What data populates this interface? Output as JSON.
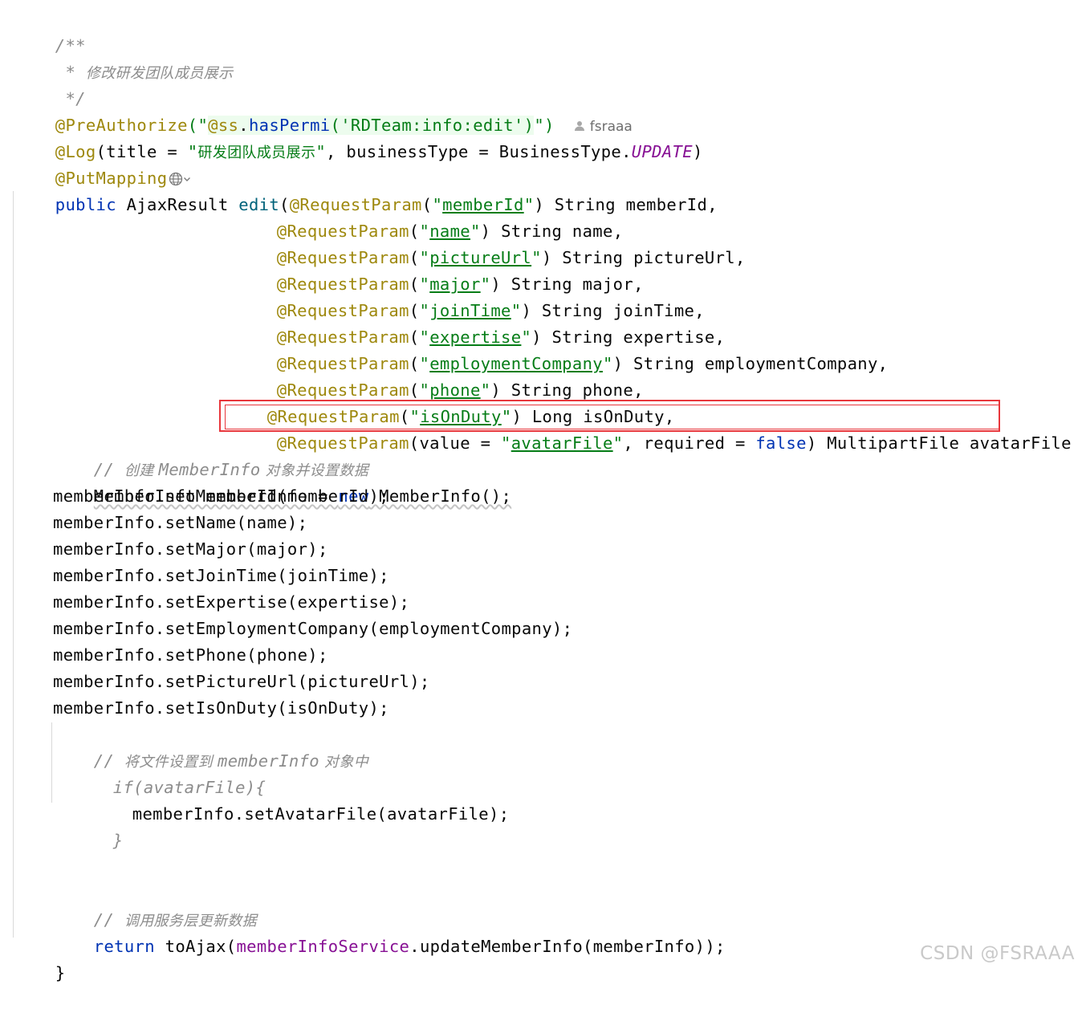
{
  "code": {
    "l1": "/**",
    "l2_star": " * ",
    "l2_text": "修改研发团队成员展示",
    "l3": " */",
    "preauth_ann": "@PreAuthorize",
    "preauth_open": "(\"",
    "preauth_expr_ss": "@ss",
    "preauth_expr_dot": ".",
    "preauth_expr_method": "hasPermi",
    "preauth_expr_args": "('RDTeam:info:edit')",
    "preauth_close": "\")",
    "author": "fsraaa",
    "log_ann": "@Log",
    "log_args_a": "(title = ",
    "log_title_open": "\"",
    "log_title": "研发团队成员展示",
    "log_title_close": "\"",
    "log_args_b": ", businessType = BusinessType.",
    "log_update": "UPDATE",
    "log_args_c": ")",
    "put_ann": "@PutMapping",
    "sig_public": "public",
    "sig_rest": " AjaxResult ",
    "sig_method": "edit",
    "sig_paren": "(",
    "rp_ann": "@RequestParam",
    "params": [
      {
        "name": "memberId",
        "type": "String",
        "var": "memberId",
        "sep": ","
      },
      {
        "name": "name",
        "type": "String",
        "var": "name",
        "sep": ","
      },
      {
        "name": "pictureUrl",
        "type": "String",
        "var": "pictureUrl",
        "sep": ","
      },
      {
        "name": "major",
        "type": "String",
        "var": "major",
        "sep": ","
      },
      {
        "name": "joinTime",
        "type": "String",
        "var": "joinTime",
        "sep": ","
      },
      {
        "name": "expertise",
        "type": "String",
        "var": "expertise",
        "sep": ","
      },
      {
        "name": "employmentCompany",
        "type": "String",
        "var": "employmentCompany",
        "sep": ","
      },
      {
        "name": "phone",
        "type": "String",
        "var": "phone",
        "sep": ","
      },
      {
        "name": "isOnDuty",
        "type": "Long",
        "var": "isOnDuty",
        "sep": ","
      }
    ],
    "avatar_value_kw": "(value = ",
    "avatar_name": "avatarFile",
    "avatar_required": ", required = ",
    "avatar_false": "false",
    "avatar_rest": ") MultipartFile avatarFile ",
    "avatar_close": ") {",
    "c_create_slash": "// ",
    "c_create_a": "创建 ",
    "c_create_b": "MemberInfo",
    "c_create_c": " 对象并设置数据",
    "new_a": "MemberInfo memberInfo = ",
    "new_kw": "new",
    "new_b": " MemberInfo();",
    "setters": [
      "memberInfo.setMemberId(memberId);",
      "memberInfo.setName(name);",
      "memberInfo.setMajor(major);",
      "memberInfo.setJoinTime(joinTime);",
      "memberInfo.setExpertise(expertise);",
      "memberInfo.setEmploymentCompany(employmentCompany);",
      "memberInfo.setPhone(phone);",
      "memberInfo.setPictureUrl(pictureUrl);",
      "memberInfo.setIsOnDuty(isOnDuty);"
    ],
    "c_file_slash": "// ",
    "c_file_a": "将文件设置到 ",
    "c_file_b": "memberInfo",
    "c_file_c": " 对象中",
    "if_line": "if(avatarFile){",
    "set_avatar": "memberInfo.setAvatarFile(avatarFile);",
    "if_close": "}",
    "c_service_slash": "// ",
    "c_service_text": "调用服务层更新数据",
    "ret_kw": "return",
    "ret_a": " toAjax(",
    "ret_field": "memberInfoService",
    "ret_b": ".updateMemberInfo(memberInfo));",
    "end_brace": "}"
  },
  "watermark": "CSDN @FSRAAA",
  "colors": {
    "keyword": "#0033b3",
    "annotation": "#9e880d",
    "string": "#067d17",
    "comment": "#8c8c8c",
    "field": "#871094",
    "highlight_box": "#e8363b"
  },
  "icons": [
    "author-icon",
    "globe-icon",
    "chevron-down-icon"
  ]
}
